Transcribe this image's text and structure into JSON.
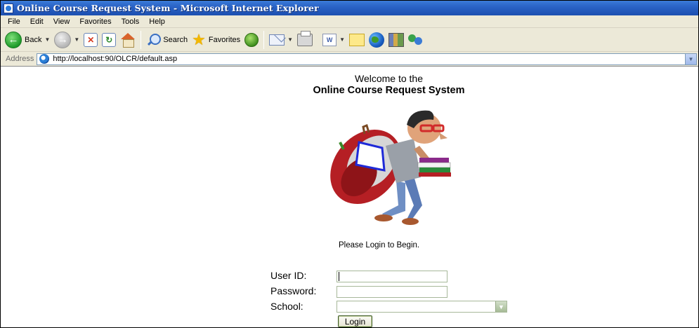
{
  "window": {
    "title": "Online Course Request System - Microsoft Internet Explorer"
  },
  "menu": [
    "File",
    "Edit",
    "View",
    "Favorites",
    "Tools",
    "Help"
  ],
  "toolbar": {
    "back_label": "Back",
    "search_label": "Search",
    "favorites_label": "Favorites"
  },
  "address": {
    "label": "Address",
    "url": "http://localhost:90/OLCR/default.asp"
  },
  "page": {
    "welcome_line1": "Welcome to the",
    "welcome_line2": "Online Course Request System",
    "login_prompt": "Please Login to Begin.",
    "user_id_label": "User ID:",
    "password_label": "Password:",
    "school_label": "School:",
    "user_id_value": "",
    "password_value": "",
    "school_selected": "",
    "login_button": "Login"
  },
  "icons": {
    "back": "back-arrow-icon",
    "forward": "forward-arrow-icon",
    "stop": "stop-icon",
    "refresh": "refresh-icon",
    "home": "home-icon",
    "search": "search-icon",
    "favorites": "favorites-star-icon",
    "history": "history-icon",
    "mail": "mail-icon",
    "print": "print-icon",
    "edit": "word-edit-icon",
    "discuss": "note-icon",
    "messenger": "messenger-icon"
  },
  "colors": {
    "titlebar": "#2a63c6",
    "chrome": "#ece9d8",
    "input_border": "#a7b89a"
  }
}
